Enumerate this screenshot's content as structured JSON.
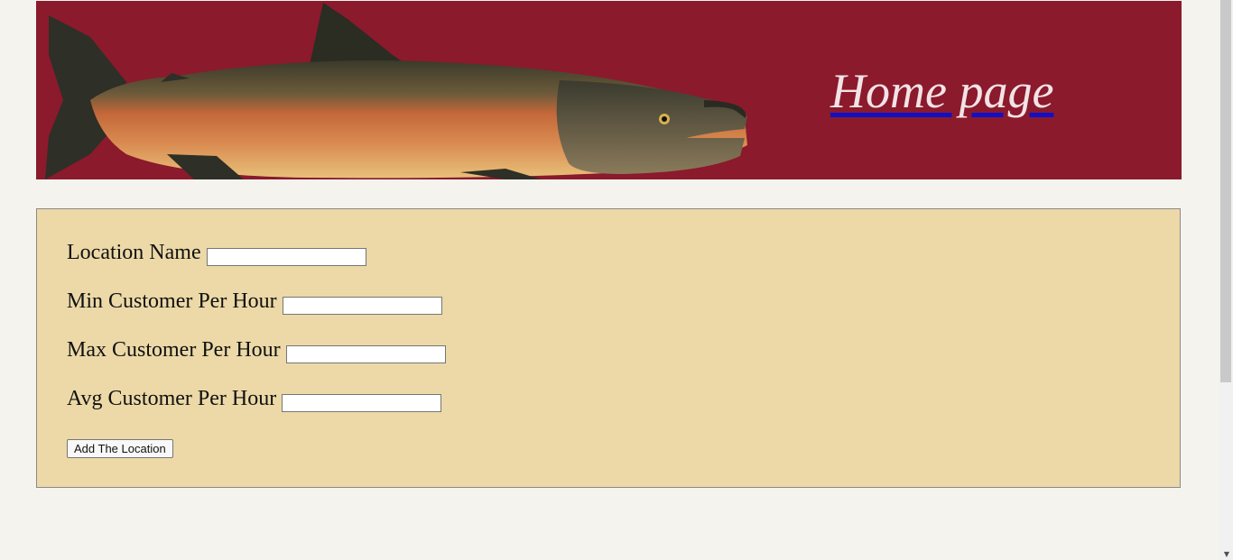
{
  "header": {
    "home_link_label": "Home page",
    "banner_color": "#8b1a2c",
    "banner_image": "salmon-fish-illustration"
  },
  "form": {
    "background_color": "#ecd9a7",
    "fields": [
      {
        "label": "Location Name",
        "value": "",
        "placeholder": ""
      },
      {
        "label": "Min Customer Per Hour",
        "value": "",
        "placeholder": ""
      },
      {
        "label": "Max Customer Per Hour",
        "value": "",
        "placeholder": ""
      },
      {
        "label": "Avg Customer Per Hour",
        "value": "",
        "placeholder": ""
      }
    ],
    "submit_label": "Add The Location"
  }
}
